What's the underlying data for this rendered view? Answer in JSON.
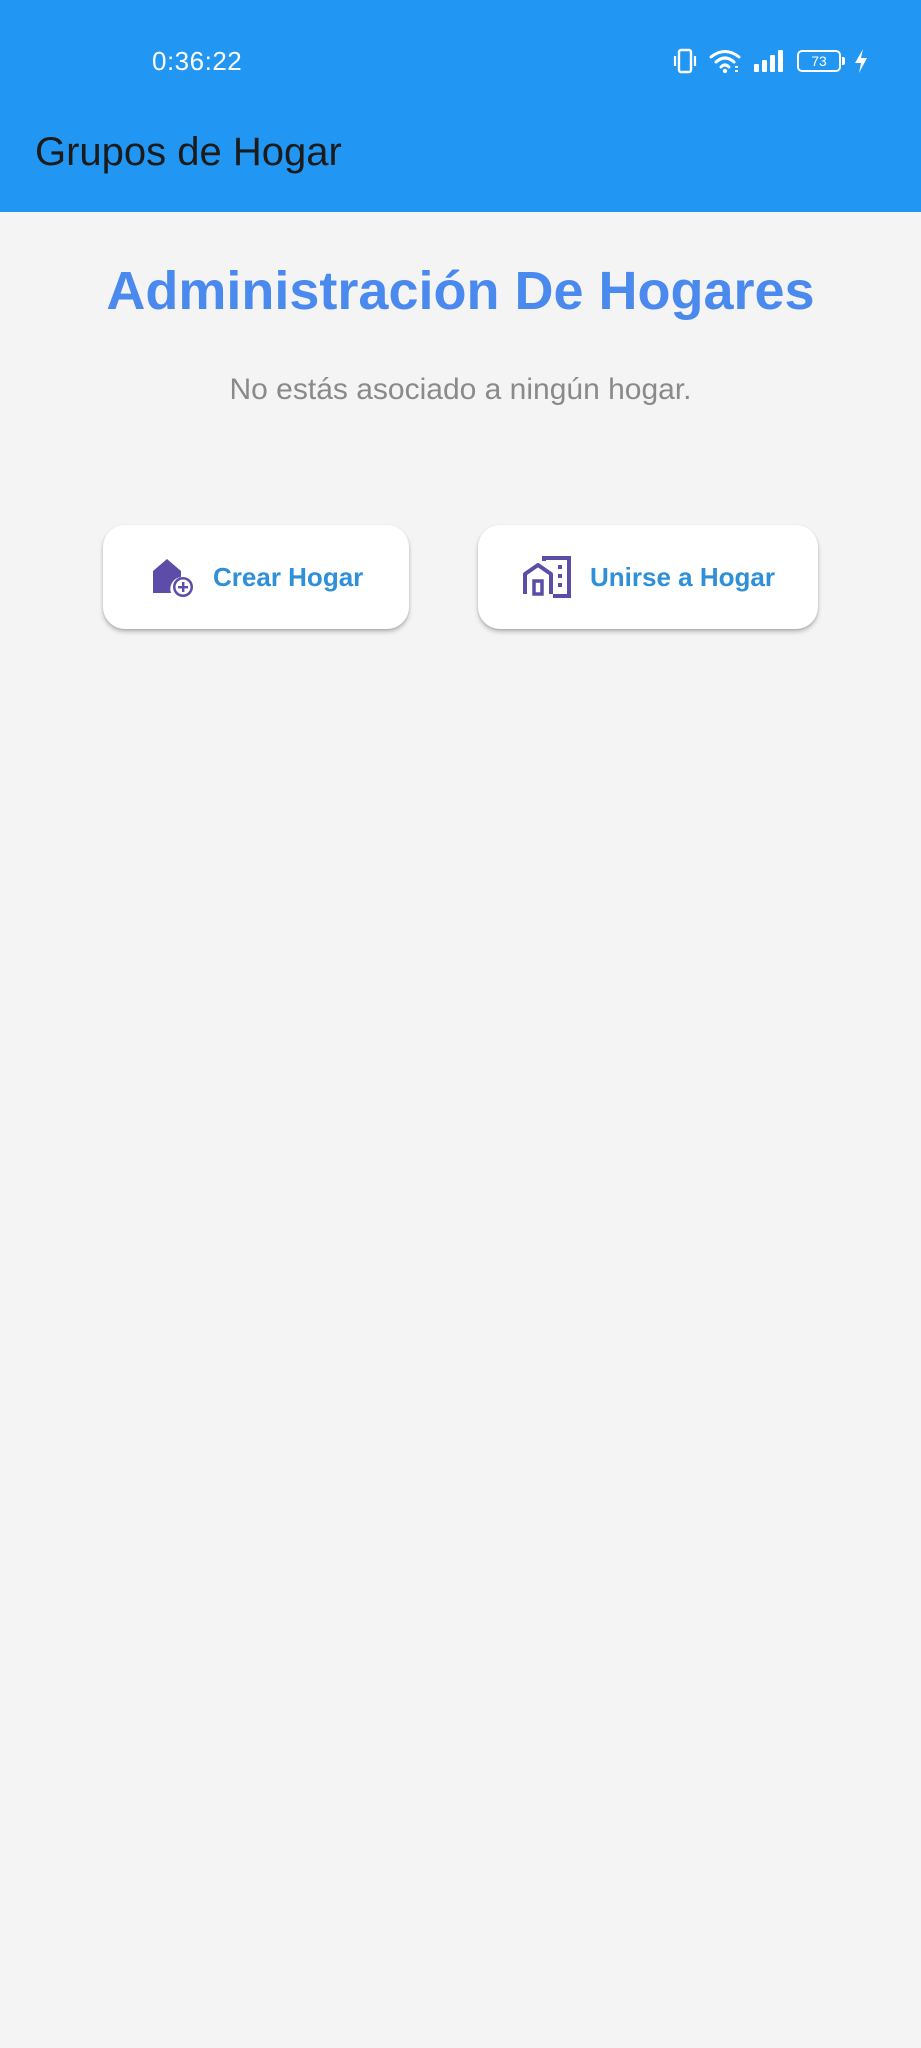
{
  "status_bar": {
    "time": "0:36:22",
    "battery_level": "73",
    "icons": [
      "vibrate-icon",
      "wifi-icon",
      "signal-icon",
      "battery-icon",
      "charging-icon"
    ]
  },
  "appbar": {
    "title": "Grupos de Hogar"
  },
  "main": {
    "heading": "Administración De Hogares",
    "empty_message": "No estás asociado a ningún hogar."
  },
  "actions": {
    "create": {
      "label": "Crear Hogar",
      "icon": "add-home-icon"
    },
    "join": {
      "label": "Unirse a Hogar",
      "icon": "home-work-icon"
    }
  },
  "colors": {
    "appbar": "#2196f3",
    "heading": "#4a89ee",
    "button_text": "#2f8fd9",
    "icon": "#5e4da8",
    "background": "#f4f4f4"
  }
}
